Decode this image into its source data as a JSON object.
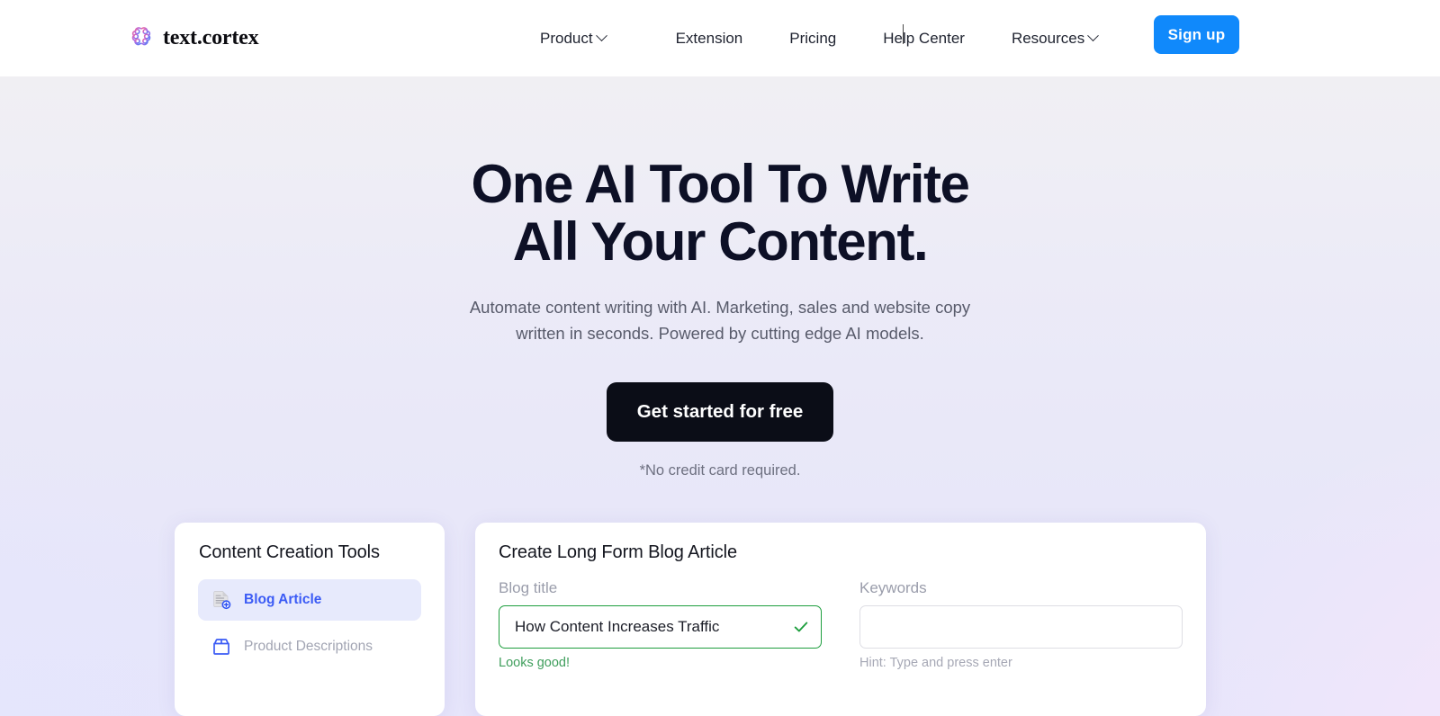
{
  "brand": {
    "name": "text.cortex",
    "logo_icon": "brain-petals-logo-icon",
    "logo_colors": [
      "#f0679b",
      "#c36de0",
      "#6d6ff2",
      "#4f7ef6"
    ]
  },
  "nav": {
    "items": [
      {
        "label": "Product",
        "has_dropdown": true,
        "icon": "chevron-down-icon"
      },
      {
        "label": "Extension",
        "has_dropdown": false
      },
      {
        "label": "Pricing",
        "has_dropdown": false
      },
      {
        "label": "Help Center",
        "has_dropdown": false
      },
      {
        "label": "Resources",
        "has_dropdown": true,
        "icon": "chevron-down-icon"
      }
    ],
    "signup_label": "Sign up",
    "signup_color": "#1089fb"
  },
  "hero": {
    "title": "One AI Tool To Write All Your Content.",
    "subtitle": "Automate content writing with AI. Marketing, sales and website copy written in seconds. Powered by cutting edge AI models.",
    "cta_label": "Get started for free",
    "cta_color": "#0b0d17",
    "cta_note": "*No credit card required."
  },
  "tools_card": {
    "title": "Content Creation Tools",
    "items": [
      {
        "label": "Blog Article",
        "icon": "document-add-icon",
        "active": true,
        "color": "#3b5bf5"
      },
      {
        "label": "Product Descriptions",
        "icon": "package-box-icon",
        "active": false,
        "color": "#a2a5b3"
      }
    ]
  },
  "form_card": {
    "title": "Create Long Form Blog Article",
    "fields": [
      {
        "label": "Blog title",
        "value": "How Content Increases Traffic",
        "placeholder": "",
        "state": "valid",
        "status_icon": "check-icon",
        "help_text": "Looks good!",
        "help_color": "#3f9e5c",
        "border_color": "#1e9e3e"
      },
      {
        "label": "Keywords",
        "value": "",
        "placeholder": "",
        "state": "empty",
        "status_icon": "",
        "help_text": "Hint: Type and press enter",
        "help_color": "#a6a8b5",
        "border_color": "#dedee4"
      }
    ]
  }
}
